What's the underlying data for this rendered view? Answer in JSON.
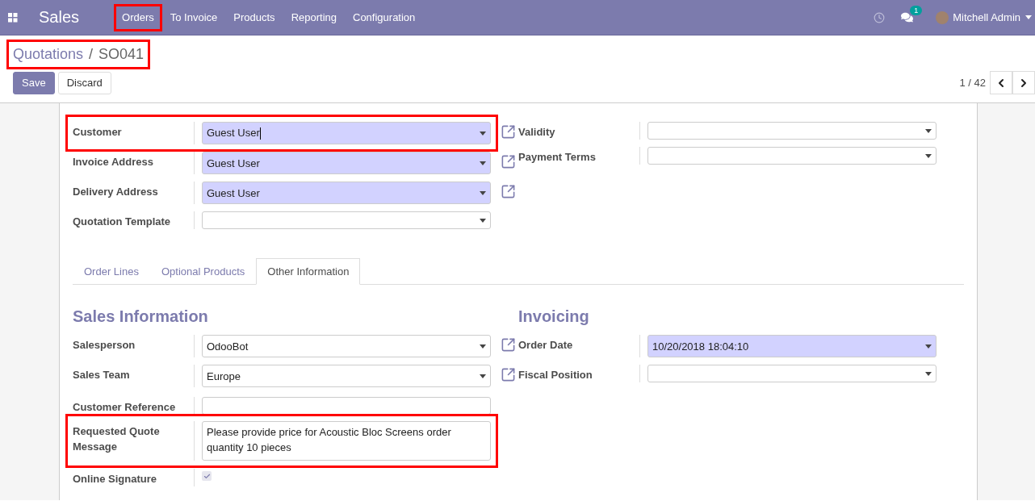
{
  "app": {
    "title": "Sales"
  },
  "nav": [
    {
      "label": "Orders",
      "highlighted": true
    },
    {
      "label": "To Invoice",
      "highlighted": false
    },
    {
      "label": "Products",
      "highlighted": false
    },
    {
      "label": "Reporting",
      "highlighted": false
    },
    {
      "label": "Configuration",
      "highlighted": false
    }
  ],
  "systray": {
    "message_count": "1",
    "user": "Mitchell Admin"
  },
  "breadcrumb": {
    "parent": "Quotations",
    "separator": "/",
    "current": "SO041",
    "highlighted": true
  },
  "buttons": [
    {
      "label": "Save",
      "kind": "primary"
    },
    {
      "label": "Discard",
      "kind": "secondary"
    }
  ],
  "pager": "1 / 42",
  "header": {
    "left": [
      {
        "label": "Customer",
        "kind": "select",
        "value": "Guest User",
        "required": true,
        "focused": true,
        "link": true,
        "highlighted": true
      },
      {
        "label": "Invoice Address",
        "kind": "select",
        "value": "Guest User",
        "required": true,
        "link": true
      },
      {
        "label": "Delivery Address",
        "kind": "select",
        "value": "Guest User",
        "required": true,
        "link": true
      },
      {
        "label": "Quotation Template",
        "kind": "select"
      }
    ],
    "right": [
      {
        "label": "Validity",
        "kind": "select"
      },
      {
        "label": "Payment Terms",
        "kind": "select"
      }
    ]
  },
  "tabs": [
    {
      "label": "Order Lines",
      "selected": false
    },
    {
      "label": "Optional Products",
      "selected": false
    },
    {
      "label": "Other Information",
      "selected": true
    }
  ],
  "sections": [
    {
      "title": "Sales Information",
      "fields": [
        {
          "label": "Salesperson",
          "kind": "select",
          "value": "OdooBot",
          "link": true
        },
        {
          "label": "Sales Team",
          "kind": "select",
          "value": "Europe",
          "link": true
        },
        {
          "label": "Customer Reference",
          "kind": "text"
        },
        {
          "label": "Requested Quote Message",
          "kind": "textarea",
          "value": "Please provide price for Acoustic Bloc Screens order quantity 10 pieces",
          "highlighted": true
        },
        {
          "label": "Online Signature",
          "kind": "checkbox",
          "checked": true
        }
      ]
    },
    {
      "title": "Invoicing",
      "fields": [
        {
          "label": "Order Date",
          "kind": "select",
          "value": "10/20/2018 18:04:10",
          "required": true
        },
        {
          "label": "Fiscal Position",
          "kind": "select"
        }
      ]
    }
  ]
}
